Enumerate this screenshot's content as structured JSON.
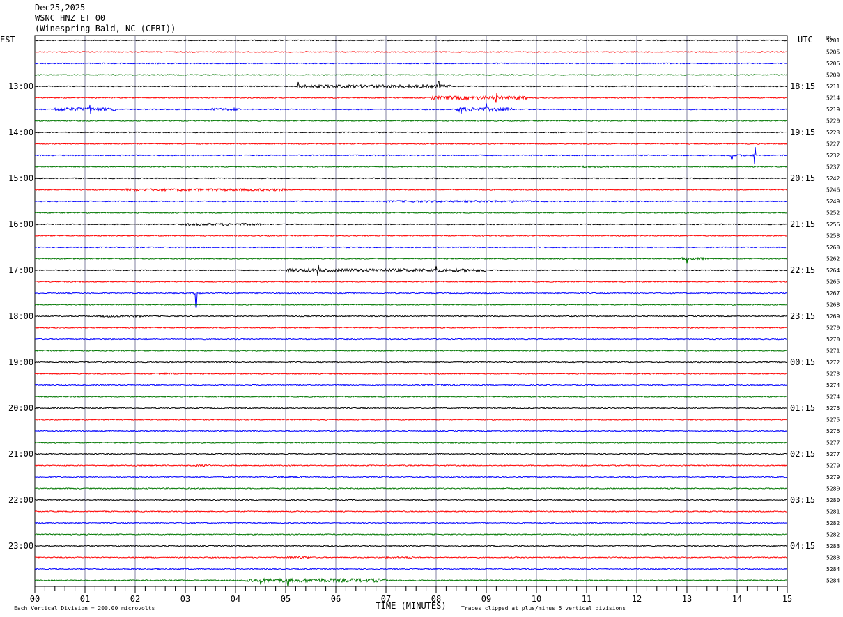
{
  "header": {
    "date": "Dec25,2025",
    "station": "WSNC HNZ ET 00",
    "location": "(Winespring Bald, NC (CERI))"
  },
  "chart_data": {
    "type": "line",
    "title": "",
    "left_axis_label": "EST",
    "right_axis_label": "UTC",
    "dc_label": "DC",
    "xlabel": "TIME (MINUTES)",
    "xlim": [
      0,
      15
    ],
    "x_ticks": [
      "00",
      "01",
      "02",
      "03",
      "04",
      "05",
      "06",
      "07",
      "08",
      "09",
      "10",
      "11",
      "12",
      "13",
      "14",
      "15"
    ],
    "left_hour_labels": [
      "13:00",
      "14:00",
      "15:00",
      "16:00",
      "17:00",
      "18:00",
      "19:00",
      "20:00",
      "21:00",
      "22:00",
      "23:00"
    ],
    "right_hour_labels": [
      "18:15",
      "19:15",
      "20:15",
      "21:15",
      "22:15",
      "23:15",
      "00:15",
      "01:15",
      "02:15",
      "03:15",
      "04:15"
    ],
    "hour_label_start_row": 4,
    "rows_per_hour": 4,
    "dc_values": [
      "5201",
      "5205",
      "5206",
      "5209",
      "5211",
      "5214",
      "5219",
      "5220",
      "5223",
      "5227",
      "5232",
      "5237",
      "5242",
      "5246",
      "5249",
      "5252",
      "5256",
      "5258",
      "5260",
      "5262",
      "5264",
      "5265",
      "5267",
      "5268",
      "5269",
      "5270",
      "5270",
      "5271",
      "5272",
      "5273",
      "5274",
      "5274",
      "5275",
      "5275",
      "5276",
      "5277",
      "5277",
      "5279",
      "5279",
      "5280",
      "5280",
      "5281",
      "5282",
      "5282",
      "5283",
      "5283",
      "5284",
      "5284"
    ],
    "trace_colors": [
      "#000000",
      "#ff0000",
      "#0000ff",
      "#007700"
    ],
    "grid": true,
    "footer_left": "Each Vertical Division =  200.00 microvolts",
    "footer_right": "Traces clipped at plus/minus 5 vertical divisions",
    "events": [
      {
        "row": 0,
        "t": [
          2,
          9
        ],
        "amp": 0.5
      },
      {
        "row": 4,
        "t": [
          5.2,
          8.3
        ],
        "amp": 2.2,
        "spikes": [
          [
            5.25,
            6
          ],
          [
            8.05,
            7
          ]
        ]
      },
      {
        "row": 5,
        "t": [
          7.9,
          9.8
        ],
        "amp": 2.5,
        "spikes": [
          [
            9.2,
            7
          ]
        ]
      },
      {
        "row": 6,
        "t": [
          0.4,
          1.6
        ],
        "amp": 2.5,
        "spikes": [
          [
            1.1,
            6
          ]
        ]
      },
      {
        "row": 6,
        "t": [
          3.5,
          4.1
        ],
        "amp": 1.8
      },
      {
        "row": 6,
        "t": [
          8.4,
          9.5
        ],
        "amp": 3.0,
        "spikes": [
          [
            8.5,
            6
          ],
          [
            9.0,
            9
          ]
        ]
      },
      {
        "row": 10,
        "t": [
          13.8,
          14.4
        ],
        "amp": 1.2,
        "spikes": [
          [
            13.9,
            6
          ],
          [
            14.35,
            12
          ]
        ]
      },
      {
        "row": 11,
        "t": [
          10.8,
          11.5
        ],
        "amp": 1.2
      },
      {
        "row": 13,
        "t": [
          1.8,
          5
        ],
        "amp": 1.6
      },
      {
        "row": 14,
        "t": [
          7,
          10
        ],
        "amp": 1.3
      },
      {
        "row": 16,
        "t": [
          3,
          4.5
        ],
        "amp": 1.6
      },
      {
        "row": 19,
        "t": [
          12.9,
          13.4
        ],
        "amp": 2.0,
        "spikes": [
          [
            13.0,
            7
          ]
        ]
      },
      {
        "row": 20,
        "t": [
          5,
          9
        ],
        "amp": 2.2,
        "spikes": [
          [
            5.65,
            8
          ],
          [
            8.0,
            6
          ]
        ]
      },
      {
        "row": 22,
        "t": [
          3.15,
          3.3
        ],
        "amp": 1.5,
        "spikes": [
          [
            3.22,
            20
          ]
        ]
      },
      {
        "row": 24,
        "t": [
          1.3,
          2.1
        ],
        "amp": 1.3
      },
      {
        "row": 29,
        "t": [
          2.4,
          2.8
        ],
        "amp": 1.4
      },
      {
        "row": 30,
        "t": [
          7.6,
          8.6
        ],
        "amp": 1.2
      },
      {
        "row": 37,
        "t": [
          3.2,
          3.5
        ],
        "amp": 1.4
      },
      {
        "row": 38,
        "t": [
          4.8,
          5.4
        ],
        "amp": 1.3
      },
      {
        "row": 45,
        "t": [
          5,
          5.5
        ],
        "amp": 1.6
      },
      {
        "row": 45,
        "t": [
          7,
          7.6
        ],
        "amp": 1.2
      },
      {
        "row": 46,
        "t": [
          2,
          3
        ],
        "amp": 1.0
      },
      {
        "row": 47,
        "t": [
          4.2,
          7.0
        ],
        "amp": 2.6,
        "spikes": [
          [
            4.5,
            6
          ],
          [
            5.05,
            8
          ]
        ]
      }
    ]
  }
}
